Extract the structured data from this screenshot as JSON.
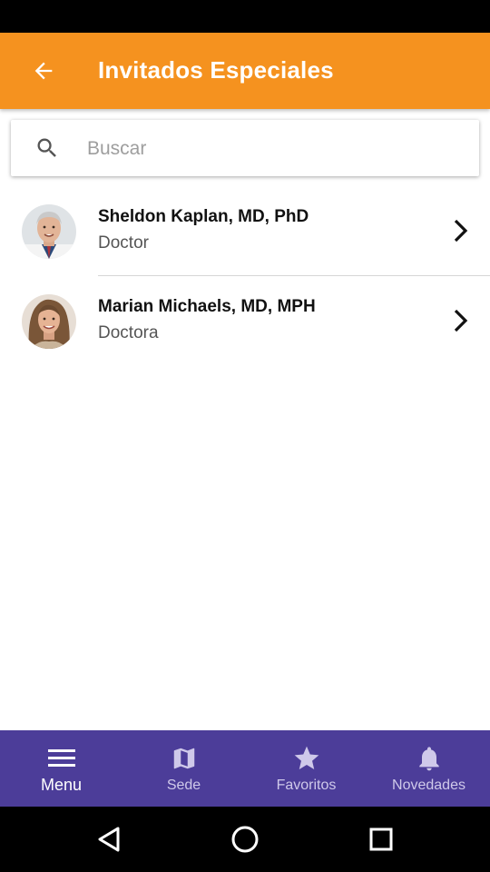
{
  "header": {
    "title": "Invitados Especiales",
    "back_icon": "arrow-left-icon"
  },
  "search": {
    "placeholder": "Buscar",
    "value": ""
  },
  "guests": [
    {
      "name": "Sheldon Kaplan, MD, PhD",
      "role": "Doctor"
    },
    {
      "name": "Marian Michaels, MD, MPH",
      "role": "Doctora"
    }
  ],
  "bottom_nav": {
    "items": [
      {
        "label": "Menu",
        "icon": "menu-icon",
        "active": true
      },
      {
        "label": "Sede",
        "icon": "map-icon",
        "active": false
      },
      {
        "label": "Favoritos",
        "icon": "star-icon",
        "active": false
      },
      {
        "label": "Novedades",
        "icon": "bell-icon",
        "active": false
      }
    ]
  },
  "colors": {
    "app_bar": "#f5921f",
    "bottom_nav": "#4c3d99",
    "nav_label_inactive": "#cfc9ea",
    "status_bar": "#000000"
  }
}
